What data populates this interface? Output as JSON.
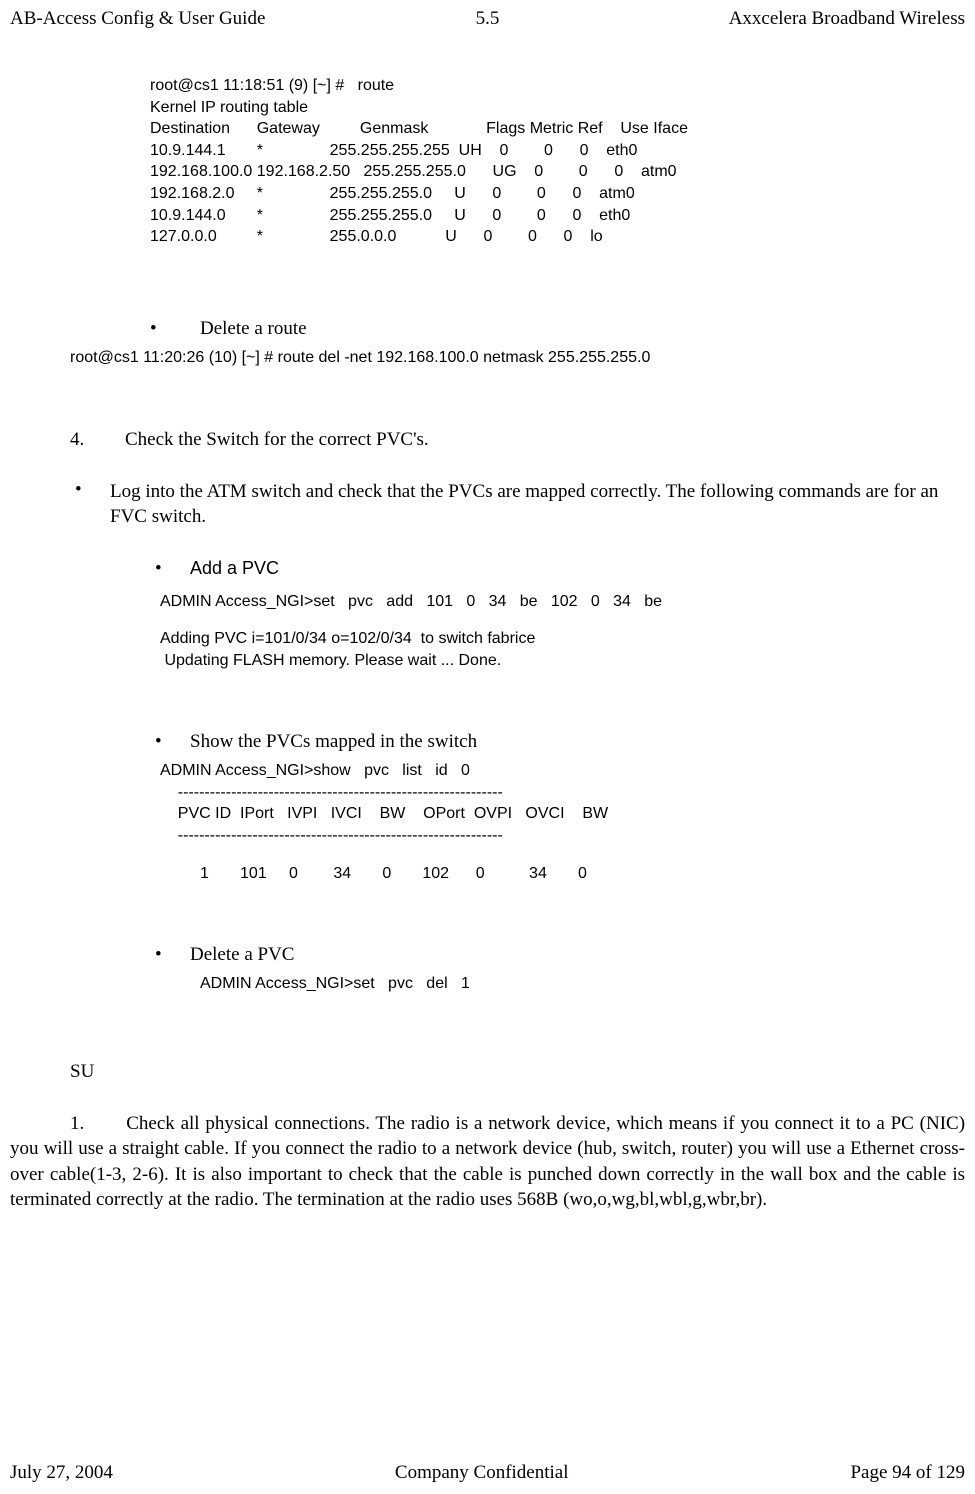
{
  "header": {
    "left": "AB-Access Config & User Guide",
    "center": "5.5",
    "right": "Axxcelera Broadband Wireless"
  },
  "routing": {
    "prompt": "root@cs1 11:18:51 (9) [~] #   route",
    "title": "Kernel IP routing table",
    "cols": "Destination      Gateway         Genmask             Flags Metric Ref    Use Iface",
    "rows": [
      "10.9.144.1       *               255.255.255.255  UH    0        0      0    eth0",
      "192.168.100.0 192.168.2.50   255.255.255.0      UG    0        0      0    atm0",
      "192.168.2.0     *               255.255.255.0     U      0        0      0    atm0",
      "10.9.144.0       *               255.255.255.0     U      0        0      0    eth0",
      "127.0.0.0         *               255.0.0.0           U      0        0      0    lo"
    ]
  },
  "bullets": {
    "delete_route": "Delete a route"
  },
  "cmd_delete_route": "root@cs1 11:20:26 (10) [~] #   route   del   -net   192.168.100.0   netmask   255.255.255.0",
  "step4": {
    "num": "4.",
    "text": "Check the Switch for the correct PVC's."
  },
  "log_into": "Log into the ATM switch and check that the PVCs are mapped correctly. The following commands are for an FVC switch.",
  "add_pvc": {
    "label": "Add a PVC",
    "cmd": "ADMIN Access_NGI>set   pvc   add   101   0   34   be   102   0   34   be",
    "out1": "Adding PVC i=101/0/34 o=102/0/34  to switch fabrice",
    "out2": " Updating FLASH memory. Please wait ... Done."
  },
  "show_pvc": {
    "label": "Show the PVCs mapped in the switch",
    "cmd": "ADMIN Access_NGI>show   pvc   list   id   0",
    "sep": "    -------------------------------------------------------------",
    "cols": "    PVC ID  IPort   IVPI   IVCI    BW    OPort  OVPI   OVCI    BW",
    "row": "         1       101     0        34       0       102      0          34       0"
  },
  "delete_pvc": {
    "label": "Delete a PVC",
    "cmd": "ADMIN Access_NGI>set   pvc   del   1"
  },
  "su": "SU",
  "step1": {
    "num": "1.",
    "lead": "Check all physical connections. The radio is a network device, which means if you",
    "rest": "connect it to a PC (NIC) you will use a straight cable. If you  connect the radio to a network device (hub, switch, router) you will use a Ethernet cross-over cable(1-3, 2-6). It is also important to check that the cable is punched down correctly in the wall box and the cable is terminated correctly at the radio. The termination at the radio uses 568B (wo,o,wg,bl,wbl,g,wbr,br)."
  },
  "footer": {
    "left": "July 27, 2004",
    "center": "Company Confidential",
    "right": "Page 94 of 129"
  }
}
